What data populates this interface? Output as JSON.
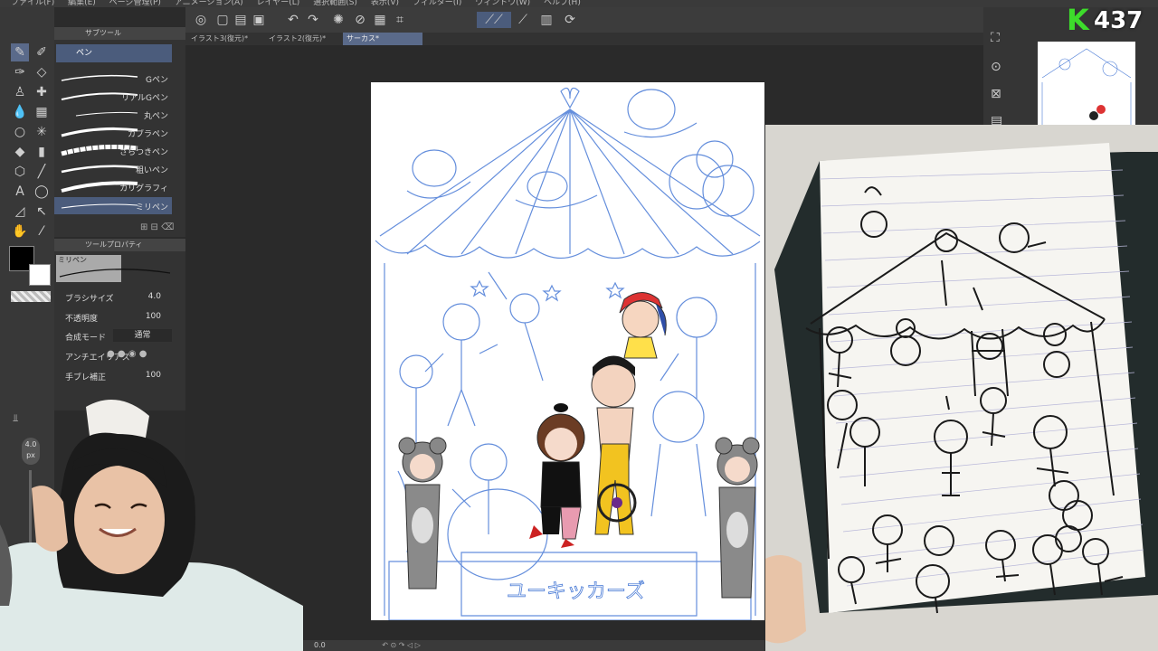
{
  "menubar": {
    "items": [
      "ファイル(F)",
      "編集(E)",
      "ページ管理(P)",
      "アニメーション(A)",
      "レイヤー(L)",
      "選択範囲(S)",
      "表示(V)",
      "フィルター(I)",
      "ウィンドウ(W)",
      "ヘルプ(H)"
    ]
  },
  "subtool": {
    "tab_label": "サブツール",
    "selected": "ペン",
    "brushes": [
      {
        "label": "Gペン"
      },
      {
        "label": "リアルGペン"
      },
      {
        "label": "丸ペン"
      },
      {
        "label": "カブラペン"
      },
      {
        "label": "さらつきペン"
      },
      {
        "label": "粗いペン"
      },
      {
        "label": "カリグラフィ"
      },
      {
        "label": "ミリペン"
      }
    ]
  },
  "toolprop": {
    "tab_label": "ツールプロパティ",
    "preview_label": "ミリペン",
    "brush_size": {
      "label": "ブラシサイズ",
      "value": "4.0"
    },
    "opacity": {
      "label": "不透明度",
      "value": "100"
    },
    "blend": {
      "label": "合成モード",
      "value": "通常"
    },
    "antialias": {
      "label": "アンチエイリアス"
    },
    "stabilization": {
      "label": "手ブレ補正",
      "value": "100"
    }
  },
  "brush_size_panel": {
    "value": "4.0",
    "unit": "px"
  },
  "tabs": [
    {
      "label": "イラスト3(復元)*",
      "active": false
    },
    {
      "label": "イラスト2(復元)*",
      "active": false
    },
    {
      "label": "サーカス*",
      "active": true
    }
  ],
  "canvas": {
    "sign_text": "ユーキッカーズ"
  },
  "status": {
    "zoom": "0.0"
  },
  "logo": {
    "letter": "K",
    "count": "437",
    "accent": "#3ddc2b"
  },
  "colors": {
    "accent_tab": "#5a6a8a",
    "sketch_blue": "#4a7bd6",
    "main": "#000000",
    "sub": "#ffffff"
  }
}
